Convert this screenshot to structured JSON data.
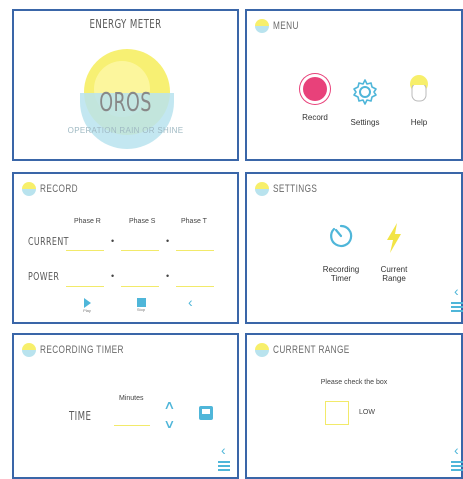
{
  "energy": {
    "title": "ENERGY METER",
    "brand": "OROS",
    "tagline": "OPERATION RAIN OR SHINE"
  },
  "menu": {
    "title": "MENU",
    "items": [
      {
        "label": "Record",
        "icon": "record-circle-icon"
      },
      {
        "label": "Settings",
        "icon": "gear-icon"
      },
      {
        "label": "Help",
        "icon": "lightbulb-icon"
      }
    ]
  },
  "record": {
    "title": "RECORD",
    "phases": [
      "Phase R",
      "Phase S",
      "Phase T"
    ],
    "rows": [
      "CURRENT",
      "POWER"
    ],
    "controls": {
      "play": "Play",
      "stop": "Stop"
    }
  },
  "settings": {
    "title": "SETTINGS",
    "items": [
      {
        "label_line1": "Recording",
        "label_line2": "Timer",
        "icon": "timer-icon"
      },
      {
        "label_line1": "Current",
        "label_line2": "Range",
        "icon": "lightning-icon"
      }
    ]
  },
  "recording_timer": {
    "title": "RECORDING TIMER",
    "field_label": "TIME",
    "unit": "Minutes"
  },
  "current_range": {
    "title": "CURRENT RANGE",
    "instruction": "Please check the box",
    "option": "LOW"
  },
  "colors": {
    "border": "#3a66a8",
    "accent_blue": "#4fb6d9",
    "accent_yellow": "#f2ea6a",
    "record_pink": "#e8417a"
  }
}
